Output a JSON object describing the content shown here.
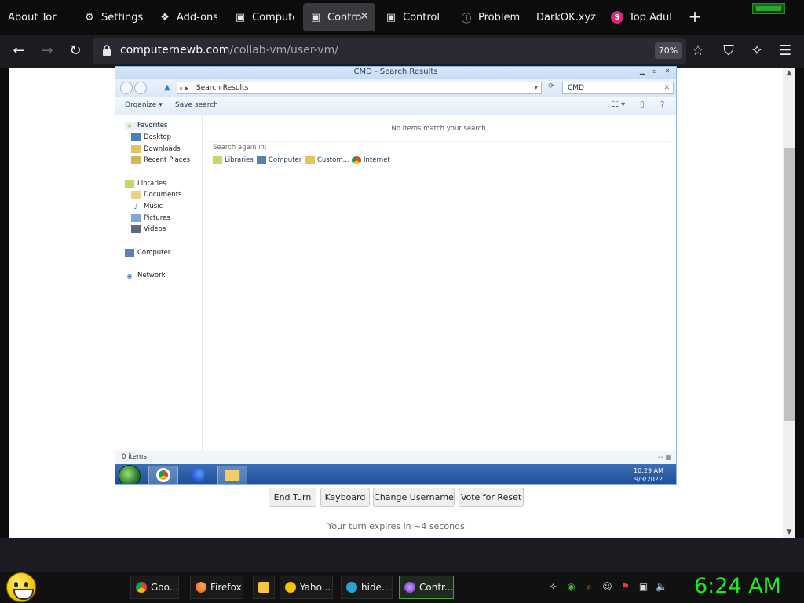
{
  "browser": {
    "tabs": [
      {
        "label": "About Tor",
        "icon": "none"
      },
      {
        "label": "Settings",
        "icon": "gear-icon"
      },
      {
        "label": "Add-ons",
        "icon": "puzzle-icon"
      },
      {
        "label": "Compute",
        "icon": "computer-icon"
      },
      {
        "label": "Contro",
        "icon": "computer-icon",
        "active": true
      },
      {
        "label": "Control C",
        "icon": "computer-icon"
      },
      {
        "label": "Problem L",
        "icon": "info-icon"
      },
      {
        "label": "DarkOK.xyz",
        "icon": "none"
      },
      {
        "label": "Top Adul",
        "icon": "s-badge-icon"
      }
    ],
    "url_host": "computernewb.com",
    "url_path": "/collab-vm/user-vm/",
    "zoom": "70%"
  },
  "vm": {
    "window_title": "CMD - Search Results",
    "address_path": "Search Results",
    "search_query": "CMD",
    "commands": {
      "organize": "Organize",
      "save_search": "Save search"
    },
    "nav": {
      "favorites": "Favorites",
      "desktop": "Desktop",
      "downloads": "Downloads",
      "recent": "Recent Places",
      "libraries": "Libraries",
      "documents": "Documents",
      "music": "Music",
      "pictures": "Pictures",
      "videos": "Videos",
      "computer": "Computer",
      "network": "Network"
    },
    "no_items": "No items match your search.",
    "search_again": "Search again in:",
    "search_locations": [
      "Libraries",
      "Computer",
      "Custom...",
      "Internet"
    ],
    "status": "0 items",
    "clock_time": "10:29 AM",
    "clock_date": "9/3/2022"
  },
  "controls": {
    "end_turn": "End Turn",
    "keyboard": "Keyboard",
    "change_username": "Change Username",
    "vote_reset": "Vote for Reset",
    "turn_text": "Your turn expires in ~4 seconds"
  },
  "host": {
    "tasks": [
      {
        "label": "Goo...",
        "color": "#4285f4"
      },
      {
        "label": "Firefox",
        "color": "#ff7139"
      },
      {
        "label": "",
        "color": "#f5c542"
      },
      {
        "label": "Yaho...",
        "color": "#f2c500"
      },
      {
        "label": "hide....",
        "color": "#2aa1da"
      },
      {
        "label": "Contr...",
        "color": "#8a4fd6"
      }
    ],
    "clock": "6:24 AM"
  }
}
